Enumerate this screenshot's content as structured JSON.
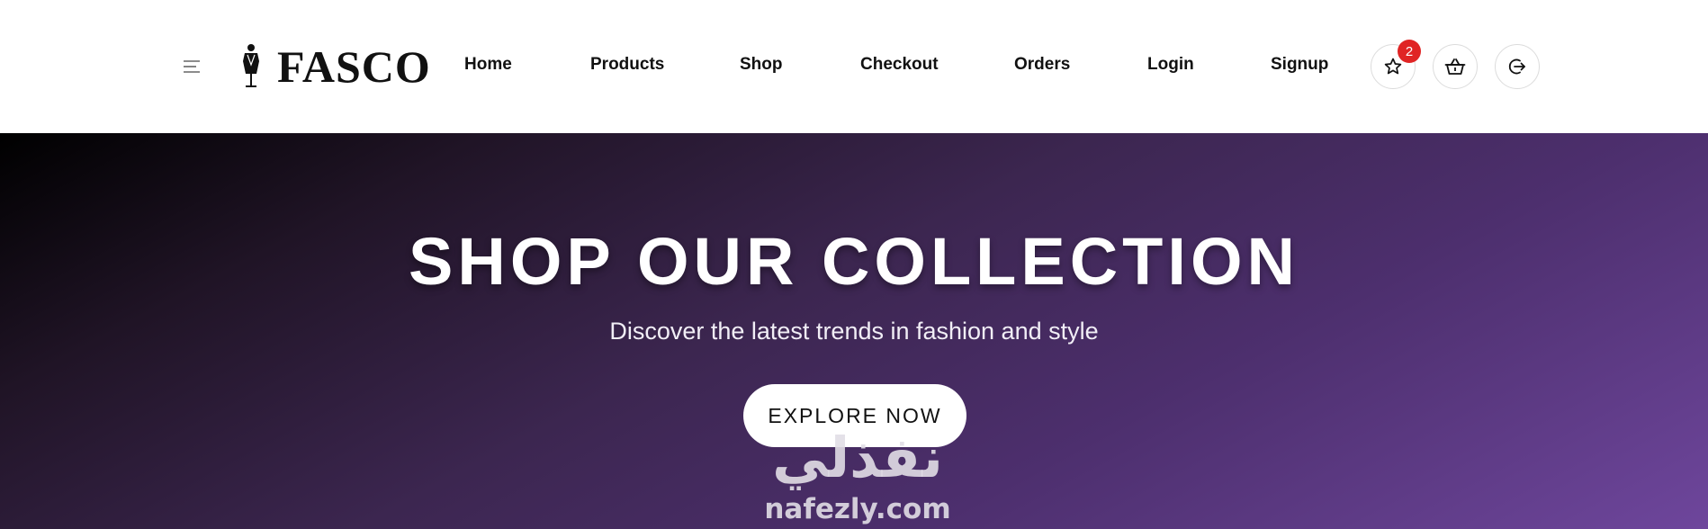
{
  "header": {
    "logo_text": "FASCO",
    "nav": [
      {
        "label": "Home"
      },
      {
        "label": "Products"
      },
      {
        "label": "Shop"
      },
      {
        "label": "Checkout"
      },
      {
        "label": "Orders"
      },
      {
        "label": "Login"
      },
      {
        "label": "Signup"
      }
    ],
    "wishlist_count": "2",
    "icons": [
      "menu-icon",
      "star-icon",
      "basket-icon",
      "logout-icon"
    ]
  },
  "hero": {
    "title": "SHOP OUR COLLECTION",
    "subtitle": "Discover the latest trends in fashion and style",
    "cta_label": "EXPLORE NOW",
    "gradient_colors": [
      "#000000",
      "#3c2650",
      "#6e469c"
    ]
  },
  "watermark": {
    "arabic": "نفذلي",
    "latin": "nafezly.com"
  },
  "colors": {
    "badge": "#e02424",
    "icon_border": "#dcdcdc"
  }
}
